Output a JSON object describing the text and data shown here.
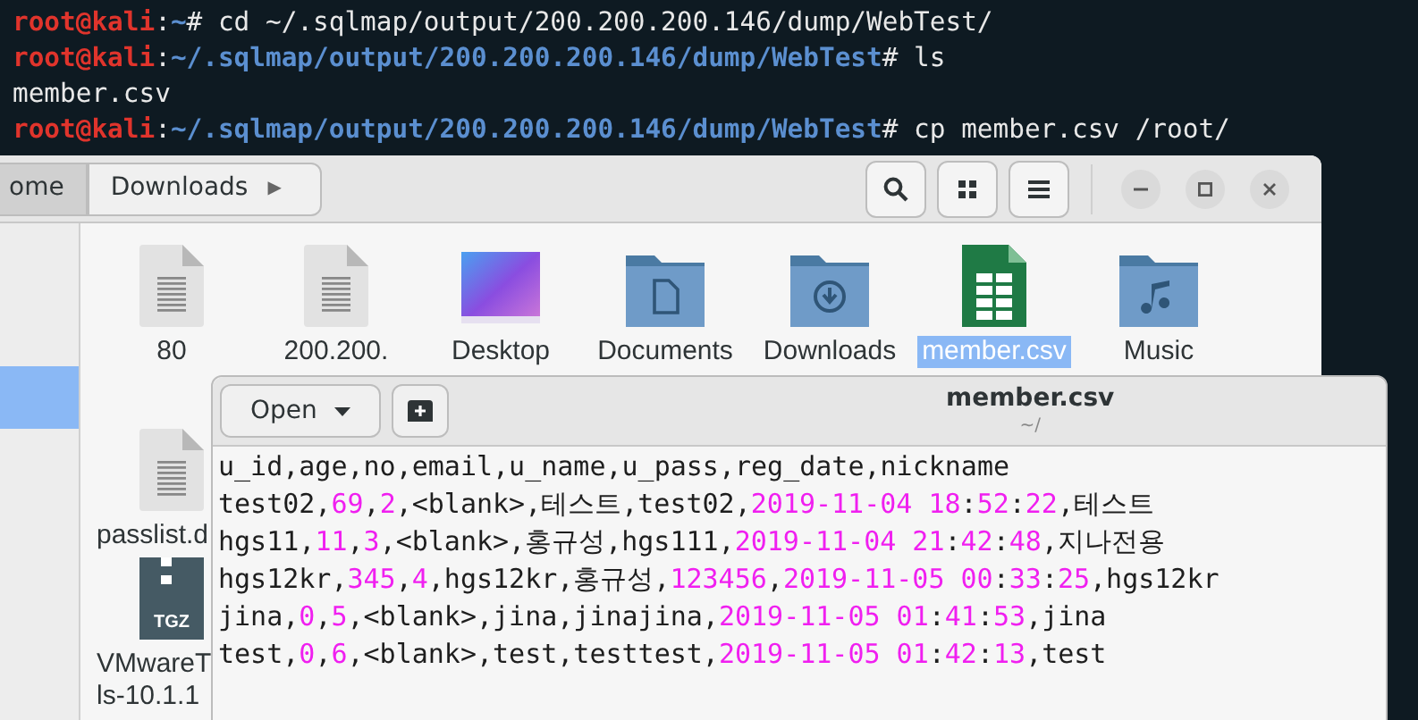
{
  "terminal": {
    "lines": [
      {
        "kind": "prompt",
        "user": "root@kali",
        "sep": ":",
        "path": "~",
        "command": "# cd ~/.sqlmap/output/200.200.200.146/dump/WebTest/"
      },
      {
        "kind": "prompt",
        "user": "root@kali",
        "sep": ":",
        "path": "~/.sqlmap/output/200.200.200.146/dump/WebTest",
        "command": "# ls"
      },
      {
        "kind": "output",
        "text": "member.csv"
      },
      {
        "kind": "prompt",
        "user": "root@kali",
        "sep": ":",
        "path": "~/.sqlmap/output/200.200.200.146/dump/WebTest",
        "command": "# cp member.csv /root/"
      }
    ]
  },
  "file_manager": {
    "path": [
      {
        "label": "ome",
        "selected": true
      },
      {
        "label": "Downloads",
        "selected": false
      }
    ],
    "path_arrow": "▶",
    "sidebar": [
      {
        "selected": true
      }
    ],
    "files": [
      {
        "kind": "text-file",
        "label": [
          "80"
        ],
        "selected": false
      },
      {
        "kind": "text-file",
        "label": [
          "200.200."
        ],
        "selected": false
      },
      {
        "kind": "desktop",
        "label": [
          "Desktop"
        ],
        "selected": false
      },
      {
        "kind": "documents",
        "label": [
          "Documents"
        ],
        "selected": false
      },
      {
        "kind": "downloads",
        "label": [
          "Downloads"
        ],
        "selected": false
      },
      {
        "kind": "spreadsheet",
        "label": [
          "member.csv"
        ],
        "selected": true
      },
      {
        "kind": "music",
        "label": [
          "Music"
        ],
        "selected": false
      },
      {
        "kind": "text-file",
        "label": [
          "passlist.d"
        ],
        "selected": false
      },
      {
        "kind": "archive",
        "badge": "TGZ",
        "label": [
          "VMwareT",
          "ls-10.1.1"
        ],
        "selected": false
      }
    ]
  },
  "editor": {
    "title": "member.csv",
    "subtitle": "~/",
    "open_button": "Open",
    "lines": [
      [
        {
          "t": "u_id,age,no,email,u_name,u_pass,reg_date,nickname",
          "kind": "plain"
        }
      ],
      [
        {
          "t": "test02,",
          "kind": "plain"
        },
        {
          "t": "69",
          "kind": "number"
        },
        {
          "t": ",",
          "kind": "plain"
        },
        {
          "t": "2",
          "kind": "number"
        },
        {
          "t": ",<blank>,테스트,test02,",
          "kind": "plain"
        },
        {
          "t": "2019-11-04 18",
          "kind": "number"
        },
        {
          "t": ":",
          "kind": "plain"
        },
        {
          "t": "52",
          "kind": "number"
        },
        {
          "t": ":",
          "kind": "plain"
        },
        {
          "t": "22",
          "kind": "number"
        },
        {
          "t": ",테스트",
          "kind": "plain"
        }
      ],
      [
        {
          "t": "hgs11,",
          "kind": "plain"
        },
        {
          "t": "11",
          "kind": "number"
        },
        {
          "t": ",",
          "kind": "plain"
        },
        {
          "t": "3",
          "kind": "number"
        },
        {
          "t": ",<blank>,홍규성,hgs111,",
          "kind": "plain"
        },
        {
          "t": "2019-11-04 21",
          "kind": "number"
        },
        {
          "t": ":",
          "kind": "plain"
        },
        {
          "t": "42",
          "kind": "number"
        },
        {
          "t": ":",
          "kind": "plain"
        },
        {
          "t": "48",
          "kind": "number"
        },
        {
          "t": ",지나전용",
          "kind": "plain"
        }
      ],
      [
        {
          "t": "hgs12kr,",
          "kind": "plain"
        },
        {
          "t": "345",
          "kind": "number"
        },
        {
          "t": ",",
          "kind": "plain"
        },
        {
          "t": "4",
          "kind": "number"
        },
        {
          "t": ",hgs12kr,홍규성,",
          "kind": "plain"
        },
        {
          "t": "123456",
          "kind": "number"
        },
        {
          "t": ",",
          "kind": "plain"
        },
        {
          "t": "2019-11-05 00",
          "kind": "number"
        },
        {
          "t": ":",
          "kind": "plain"
        },
        {
          "t": "33",
          "kind": "number"
        },
        {
          "t": ":",
          "kind": "plain"
        },
        {
          "t": "25",
          "kind": "number"
        },
        {
          "t": ",hgs12kr",
          "kind": "plain"
        }
      ],
      [
        {
          "t": "jina,",
          "kind": "plain"
        },
        {
          "t": "0",
          "kind": "number"
        },
        {
          "t": ",",
          "kind": "plain"
        },
        {
          "t": "5",
          "kind": "number"
        },
        {
          "t": ",<blank>,jina,jinajina,",
          "kind": "plain"
        },
        {
          "t": "2019-11-05 01",
          "kind": "number"
        },
        {
          "t": ":",
          "kind": "plain"
        },
        {
          "t": "41",
          "kind": "number"
        },
        {
          "t": ":",
          "kind": "plain"
        },
        {
          "t": "53",
          "kind": "number"
        },
        {
          "t": ",jina",
          "kind": "plain"
        }
      ],
      [
        {
          "t": "test,",
          "kind": "plain"
        },
        {
          "t": "0",
          "kind": "number"
        },
        {
          "t": ",",
          "kind": "plain"
        },
        {
          "t": "6",
          "kind": "number"
        },
        {
          "t": ",<blank>,test,testtest,",
          "kind": "plain"
        },
        {
          "t": "2019-11-05 01",
          "kind": "number"
        },
        {
          "t": ":",
          "kind": "plain"
        },
        {
          "t": "42",
          "kind": "number"
        },
        {
          "t": ":",
          "kind": "plain"
        },
        {
          "t": "13",
          "kind": "number"
        },
        {
          "t": ",test",
          "kind": "plain"
        }
      ]
    ]
  }
}
